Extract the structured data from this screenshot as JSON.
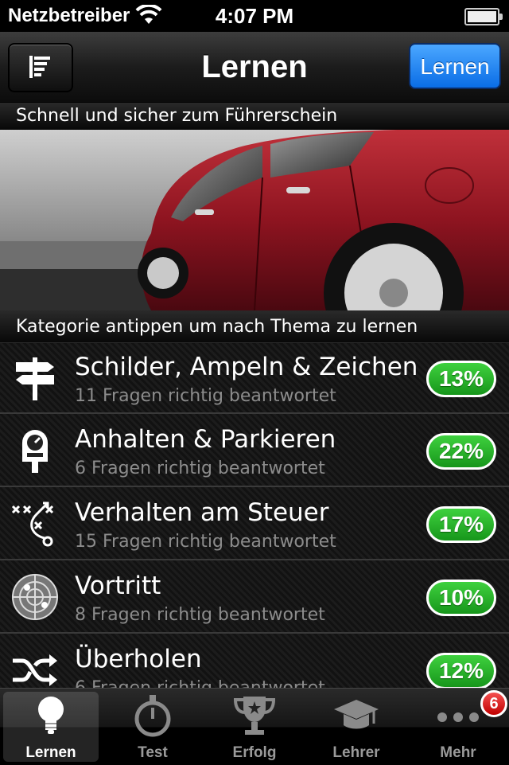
{
  "status_bar": {
    "carrier": "Netzbetreiber",
    "time": "4:07 PM"
  },
  "nav": {
    "title": "Lernen",
    "action_label": "Lernen"
  },
  "sections": {
    "intro": "Schnell und sicher zum Führerschein",
    "instruction": "Kategorie antippen um nach Thema zu lernen"
  },
  "categories": [
    {
      "label": "Schilder, Ampeln & Zeichen",
      "subtitle": "11 Fragen richtig beantwortet",
      "percent": "13%",
      "icon": "signpost-icon"
    },
    {
      "label": "Anhalten & Parkieren",
      "subtitle": "6 Fragen richtig beantwortet",
      "percent": "22%",
      "icon": "parking-meter-icon"
    },
    {
      "label": "Verhalten am Steuer",
      "subtitle": "15 Fragen richtig beantwortet",
      "percent": "17%",
      "icon": "tactics-icon"
    },
    {
      "label": "Vortritt",
      "subtitle": "8 Fragen richtig beantwortet",
      "percent": "10%",
      "icon": "radar-icon"
    },
    {
      "label": "Überholen",
      "subtitle": "6 Fragen richtig beantwortet",
      "percent": "12%",
      "icon": "shuffle-icon"
    }
  ],
  "tabs": [
    {
      "label": "Lernen",
      "icon": "lightbulb-icon",
      "active": true
    },
    {
      "label": "Test",
      "icon": "stopwatch-icon"
    },
    {
      "label": "Erfolg",
      "icon": "trophy-icon"
    },
    {
      "label": "Lehrer",
      "icon": "graduation-cap-icon"
    },
    {
      "label": "Mehr",
      "icon": "more-icon",
      "badge": "6"
    }
  ],
  "colors": {
    "accent_blue": "#1a7ff0",
    "progress_green": "#2bbb2d",
    "badge_red": "#e01b1b"
  }
}
